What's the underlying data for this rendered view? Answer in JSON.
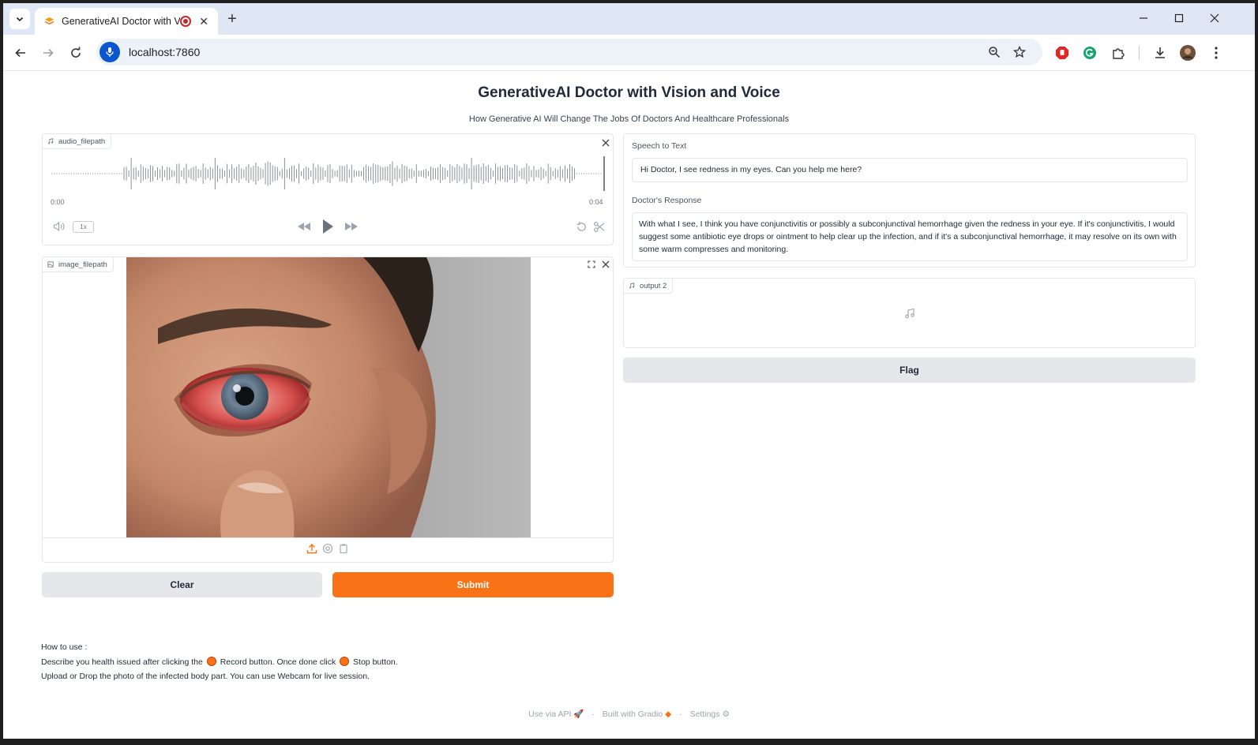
{
  "browser": {
    "tab_title": "GenerativeAI Doctor with Vi",
    "url": "localhost:7860"
  },
  "app": {
    "title": "GenerativeAI Doctor with Vision and Voice",
    "subtitle": "How Generative AI Will Change The Jobs Of Doctors And Healthcare Professionals"
  },
  "audio_input": {
    "label": "audio_filepath",
    "time_start": "0:00",
    "time_end": "0:04",
    "speed": "1x"
  },
  "image_input": {
    "label": "image_filepath"
  },
  "buttons": {
    "clear": "Clear",
    "submit": "Submit",
    "flag": "Flag"
  },
  "outputs": {
    "speech_label": "Speech to Text",
    "speech_text": "Hi Doctor, I see redness in my eyes. Can you help me here?",
    "response_label": "Doctor's Response",
    "response_text": "With what I see, I think you have conjunctivitis or possibly a subconjunctival hemorrhage given the redness in your eye. If it's conjunctivitis, I would suggest some antibiotic eye drops or ointment to help clear up the infection, and if it's a subconjunctival hemorrhage, it may resolve on its own with some warm compresses and monitoring.",
    "audio_output_label": "output 2"
  },
  "howto": {
    "heading": "How to use :",
    "line1_a": "Describe you health issued after clicking the",
    "line1_b": "Record button. Once done click",
    "line1_c": "Stop button.",
    "line2": "Upload or Drop the photo of the infected body part. You can use Webcam for live session."
  },
  "footer": {
    "api": "Use via API",
    "built": "Built with Gradio",
    "settings": "Settings"
  },
  "colors": {
    "accent": "#f97316",
    "secondary_button": "#e5e7eb",
    "tab_bar": "#dfe7f5"
  }
}
